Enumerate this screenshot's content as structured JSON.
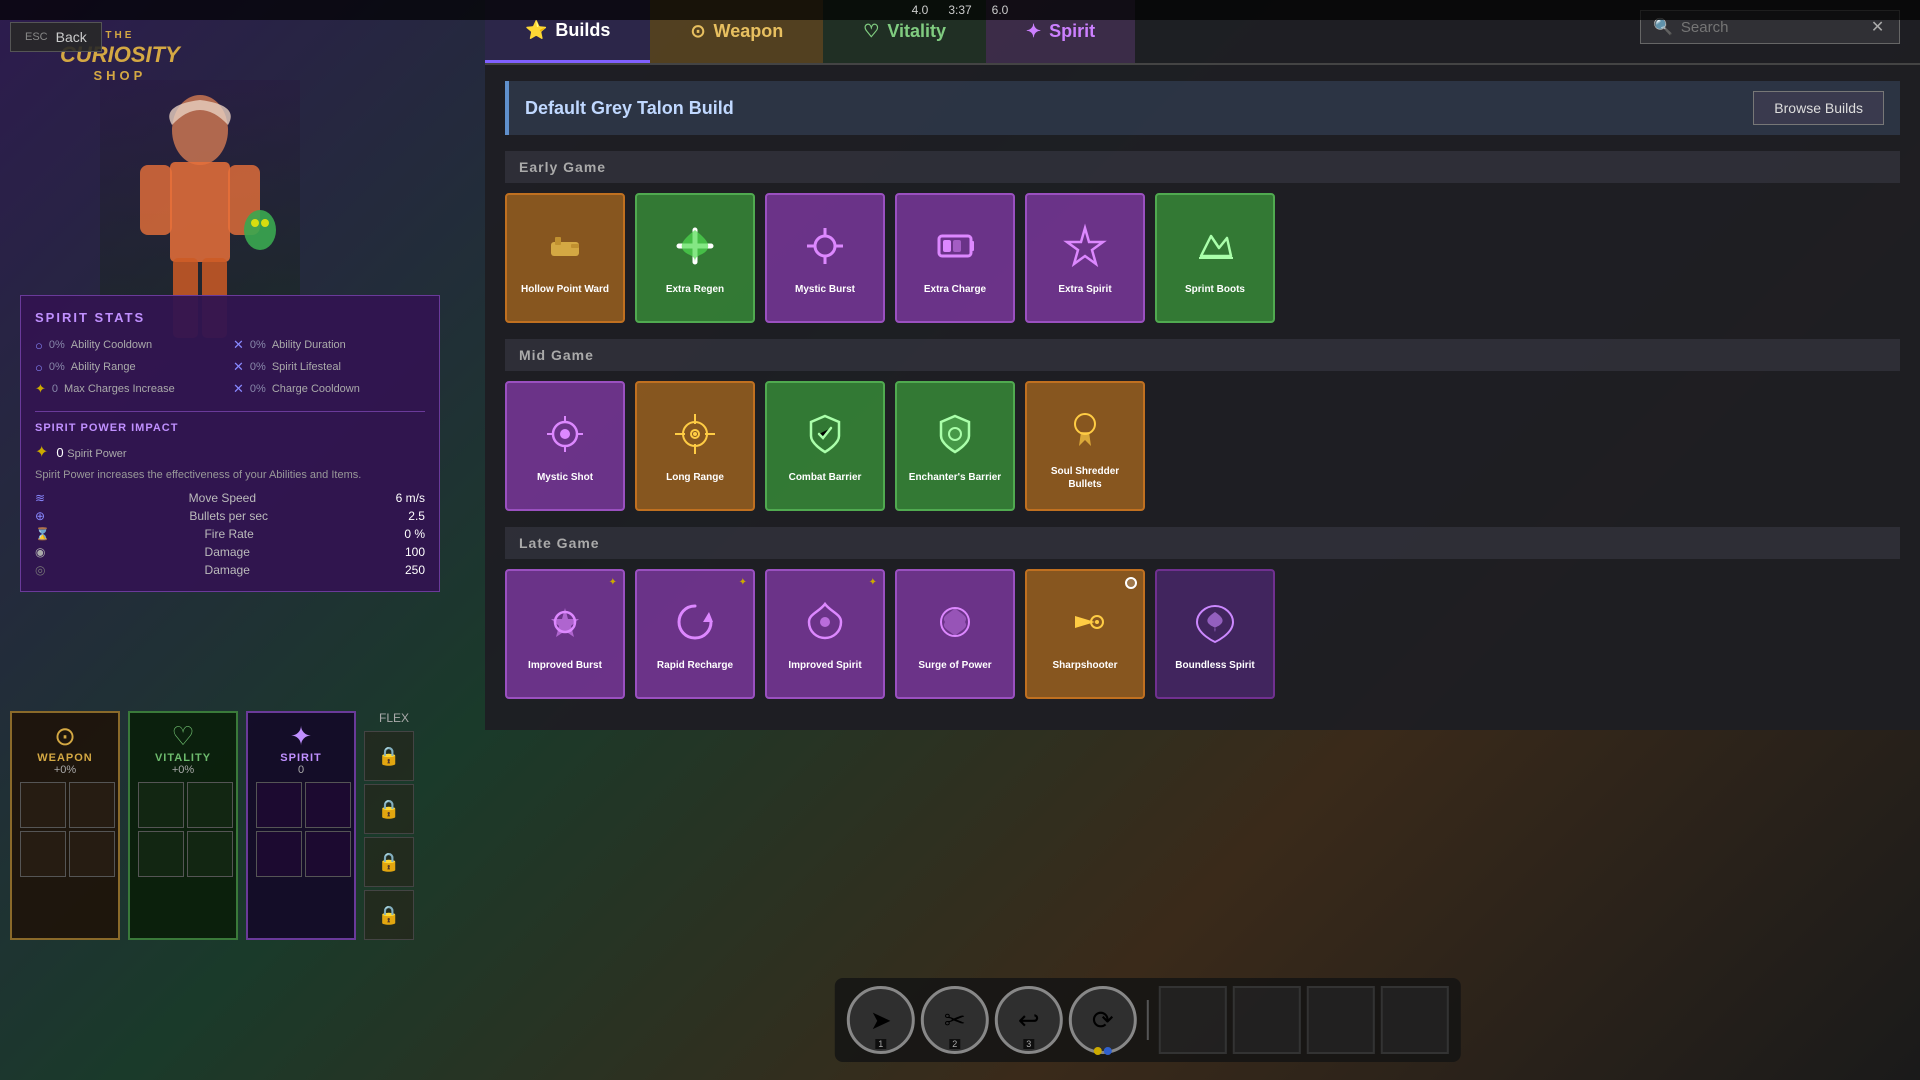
{
  "topbar": {
    "score1": "4.0",
    "timer": "3:37",
    "score2": "6.0"
  },
  "back_button": {
    "esc_label": "ESC",
    "label": "Back"
  },
  "shop": {
    "the": "THE",
    "curiosity": "CURIOSITY",
    "shop": "SHOP"
  },
  "spirit_stats": {
    "title": "SPIRIT STATS",
    "stats": [
      {
        "label": "Ability Cooldown",
        "value": "0%",
        "icon": "○"
      },
      {
        "label": "Ability Duration",
        "value": "0%",
        "icon": "✕"
      },
      {
        "label": "Ability Range",
        "value": "0%",
        "icon": "○"
      },
      {
        "label": "Spirit Lifesteal",
        "value": "0%",
        "icon": "✕"
      },
      {
        "label": "Max Charges Increase",
        "value": "0",
        "icon": "✦"
      },
      {
        "label": "Charge Cooldown",
        "value": "0%",
        "icon": "✕"
      }
    ],
    "spirit_power": {
      "title": "SPIRIT POWER IMPACT",
      "move_speed_label": "Move Speed",
      "move_speed_value": "6 m/s",
      "bullets_label": "Bullets per sec",
      "bullets_value": "2.5",
      "fire_rate_label": "Fire Rate",
      "fire_rate_value": "0 %",
      "damage1_label": "Damage",
      "damage1_value": "100",
      "damage2_label": "Damage",
      "damage2_value": "250",
      "spirit_power_label": "Spirit Power",
      "spirit_power_value": "0",
      "description": "Spirit Power increases the effectiveness of your Abilities and Items."
    }
  },
  "bottom_cards": [
    {
      "name": "WEAPON",
      "value": "+0%",
      "type": "weapon",
      "icon": "⊙"
    },
    {
      "name": "VITALITY",
      "value": "+0%",
      "type": "vitality",
      "icon": "♡"
    },
    {
      "name": "SPIRIT",
      "value": "0",
      "type": "spirit",
      "icon": "✦"
    }
  ],
  "flex_label": "FLEX",
  "tabs": [
    {
      "id": "builds",
      "label": "Builds",
      "icon": "⭐",
      "active": true
    },
    {
      "id": "weapon",
      "label": "Weapon",
      "icon": "⊙",
      "active": false
    },
    {
      "id": "vitality",
      "label": "Vitality",
      "icon": "♡",
      "active": false
    },
    {
      "id": "spirit",
      "label": "Spirit",
      "icon": "✦",
      "active": false
    }
  ],
  "search": {
    "placeholder": "Search",
    "value": ""
  },
  "build": {
    "title": "Default Grey Talon Build",
    "browse_builds_label": "Browse Builds",
    "sections": [
      {
        "id": "early",
        "label": "Early Game",
        "items": [
          {
            "name": "Hollow Point Ward",
            "color": "orange",
            "icon": "🔫"
          },
          {
            "name": "Extra Regen",
            "color": "green",
            "icon": "💚"
          },
          {
            "name": "Mystic Burst",
            "color": "purple",
            "icon": "✳"
          },
          {
            "name": "Extra Charge",
            "color": "purple",
            "icon": "⬛"
          },
          {
            "name": "Extra Spirit",
            "color": "purple",
            "icon": "💜"
          },
          {
            "name": "Sprint Boots",
            "color": "green",
            "icon": "👟"
          }
        ]
      },
      {
        "id": "mid",
        "label": "Mid Game",
        "items": [
          {
            "name": "Mystic Shot",
            "color": "purple",
            "icon": "⚡"
          },
          {
            "name": "Long Range",
            "color": "orange",
            "icon": "🎯"
          },
          {
            "name": "Combat Barrier",
            "color": "green",
            "icon": "🛡"
          },
          {
            "name": "Enchanter's Barrier",
            "color": "green",
            "icon": "🛡"
          },
          {
            "name": "Soul Shredder Bullets",
            "color": "orange",
            "icon": "💀"
          }
        ]
      },
      {
        "id": "late",
        "label": "Late Game",
        "items": [
          {
            "name": "Improved Burst",
            "color": "purple",
            "icon": "⚙"
          },
          {
            "name": "Rapid Recharge",
            "color": "purple",
            "icon": "⚡"
          },
          {
            "name": "Improved Spirit",
            "color": "purple",
            "icon": "✨"
          },
          {
            "name": "Surge of Power",
            "color": "purple",
            "icon": "🌀"
          },
          {
            "name": "Sharpshooter",
            "color": "orange",
            "icon": "▶"
          },
          {
            "name": "Boundless Spirit",
            "color": "dark-purple",
            "icon": "💎"
          }
        ]
      }
    ]
  },
  "abilities": [
    {
      "icon": "➤",
      "num": "1"
    },
    {
      "icon": "✂",
      "num": "2"
    },
    {
      "icon": "↩",
      "num": "3"
    },
    {
      "icon": "⟳",
      "num": ""
    }
  ]
}
